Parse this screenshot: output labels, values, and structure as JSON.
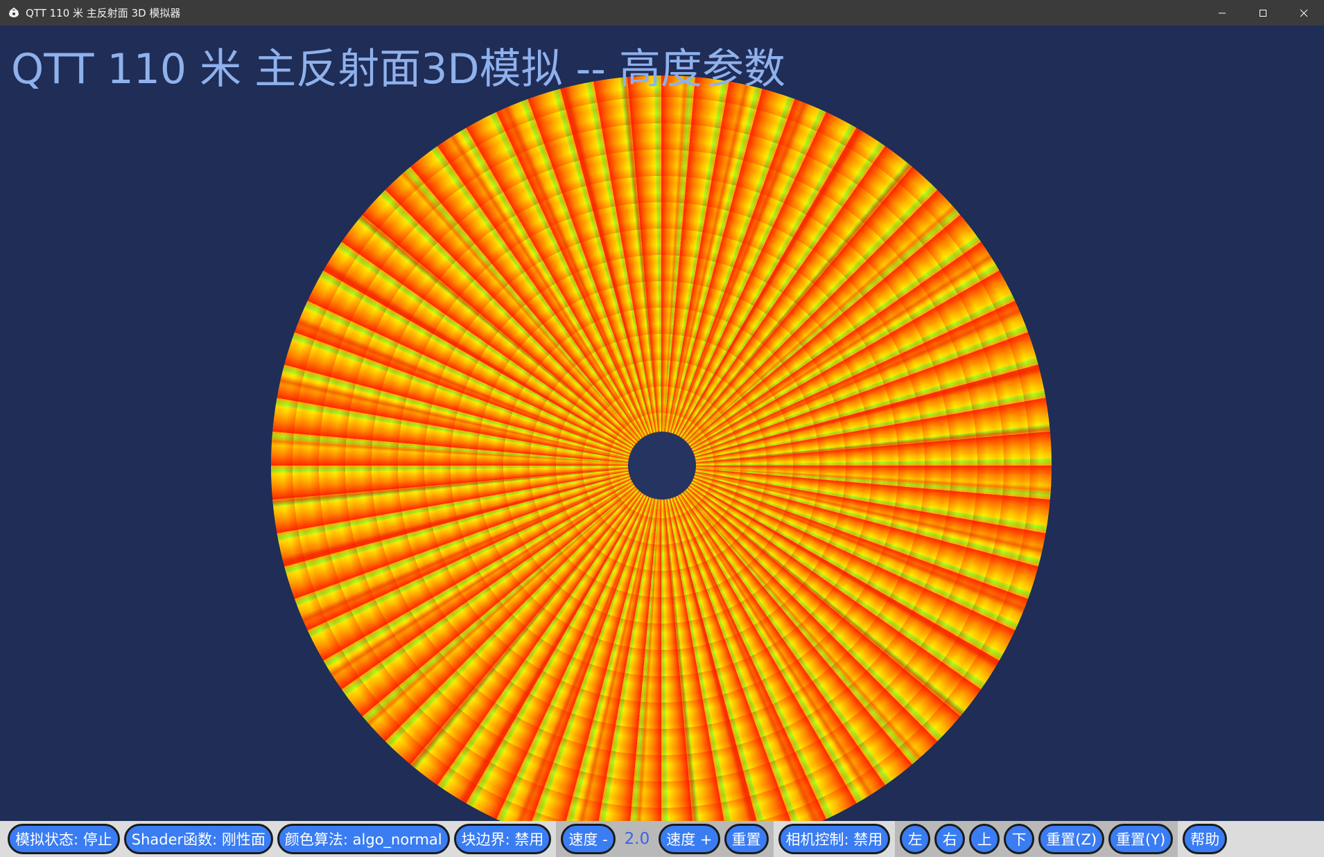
{
  "window": {
    "title": "QTT 110 米 主反射面 3D 模拟器",
    "icon": "app-logo-icon",
    "controls": [
      "minimize-icon",
      "maximize-icon",
      "close-icon"
    ]
  },
  "viewport": {
    "heading": "QTT 110 米 主反射面3D模拟 -- 高度参数",
    "background_color": "#1f2d57",
    "dish_colors": [
      "#ff2a00",
      "#ff8c00",
      "#ffd000",
      "#ffef00",
      "#9aff26"
    ]
  },
  "toolbar": {
    "sim_status": "模拟状态: 停止",
    "shader": "Shader函数: 刚性面",
    "color_algo": "颜色算法: algo_normal",
    "block_border": "块边界: 禁用",
    "speed_minus": "速度 -",
    "speed_value": "2.0",
    "speed_plus": "速度 +",
    "reset": "重置",
    "camera_control": "相机控制: 禁用",
    "left": "左",
    "right": "右",
    "up": "上",
    "down": "下",
    "reset_z": "重置(Z)",
    "reset_y": "重置(Y)",
    "help": "帮助",
    "accent_color": "#3a7cf2"
  }
}
